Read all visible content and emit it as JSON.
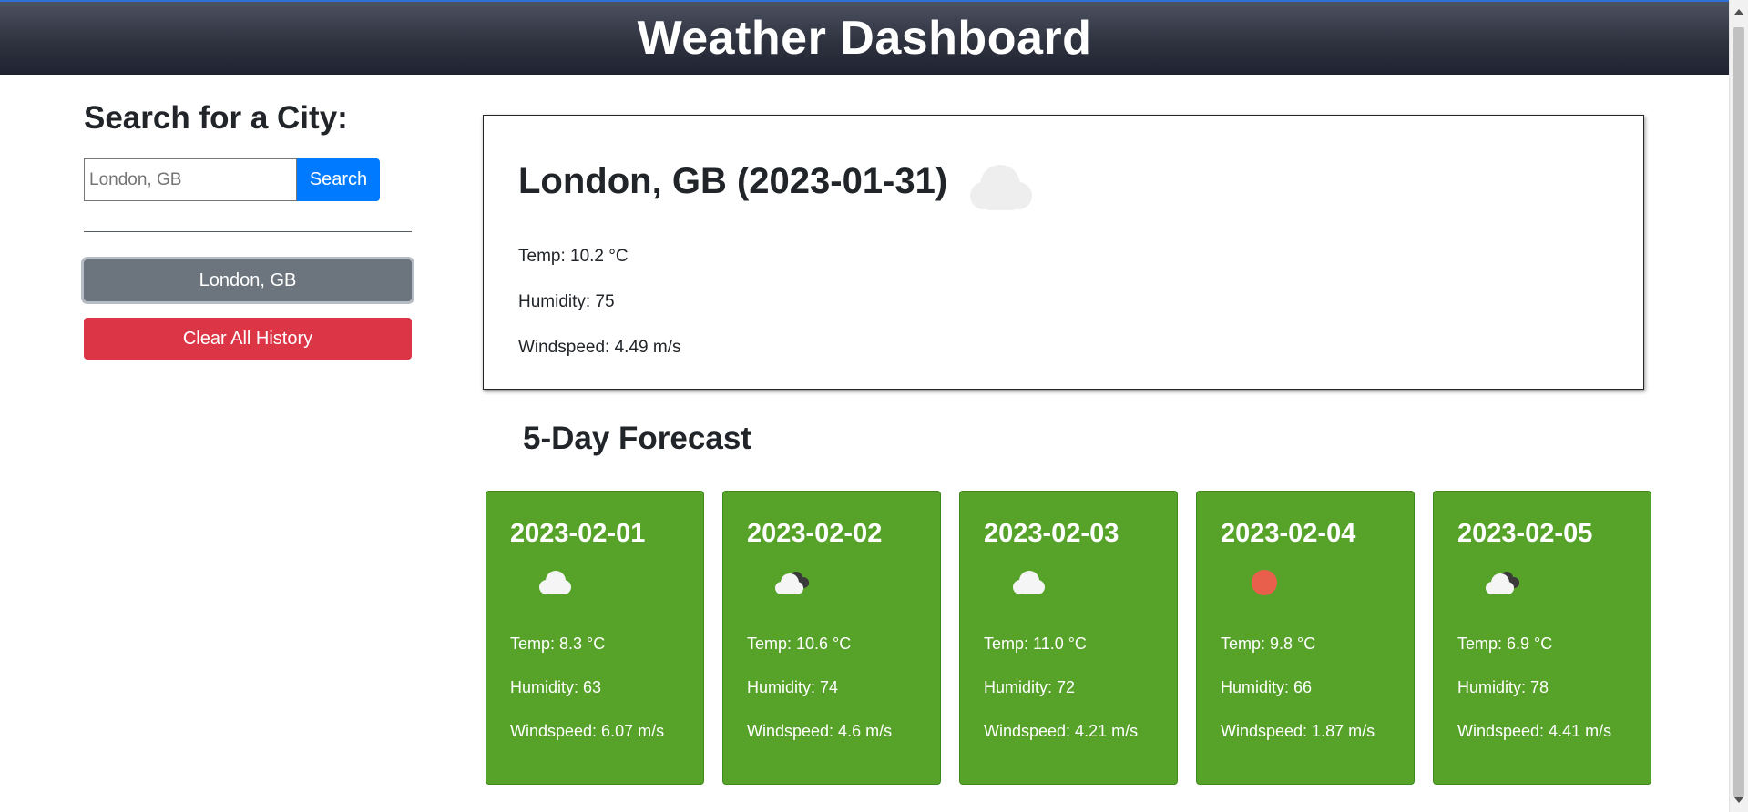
{
  "header": {
    "title": "Weather Dashboard"
  },
  "sidebar": {
    "heading": "Search for a City:",
    "search_placeholder": "London, GB",
    "search_button": "Search",
    "history": [
      "London, GB"
    ],
    "clear_button": "Clear All History"
  },
  "current": {
    "title": "London, GB (2023-01-31)",
    "icon": "cloud-icon",
    "temp": "Temp: 10.2 °C",
    "humidity": "Humidity: 75",
    "windspeed": "Windspeed: 4.49 m/s"
  },
  "forecast": {
    "title": "5-Day Forecast",
    "days": [
      {
        "date": "2023-02-01",
        "icon": "cloud-icon",
        "temp": "Temp: 8.3 °C",
        "humidity": "Humidity: 63",
        "windspeed": "Windspeed: 6.07 m/s"
      },
      {
        "date": "2023-02-02",
        "icon": "broken-clouds-icon",
        "temp": "Temp: 10.6 °C",
        "humidity": "Humidity: 74",
        "windspeed": "Windspeed: 4.6 m/s"
      },
      {
        "date": "2023-02-03",
        "icon": "cloud-icon",
        "temp": "Temp: 11.0 °C",
        "humidity": "Humidity: 72",
        "windspeed": "Windspeed: 4.21 m/s"
      },
      {
        "date": "2023-02-04",
        "icon": "sun-icon",
        "temp": "Temp: 9.8 °C",
        "humidity": "Humidity: 66",
        "windspeed": "Windspeed: 1.87 m/s"
      },
      {
        "date": "2023-02-05",
        "icon": "broken-clouds-icon",
        "temp": "Temp: 6.9 °C",
        "humidity": "Humidity: 78",
        "windspeed": "Windspeed: 4.41 m/s"
      }
    ]
  },
  "colors": {
    "header_bg": "#2f3340",
    "search_button": "#007bff",
    "history_button": "#6c757d",
    "clear_button": "#dc3545",
    "forecast_card": "#57a32a",
    "sun": "#e8604c"
  }
}
